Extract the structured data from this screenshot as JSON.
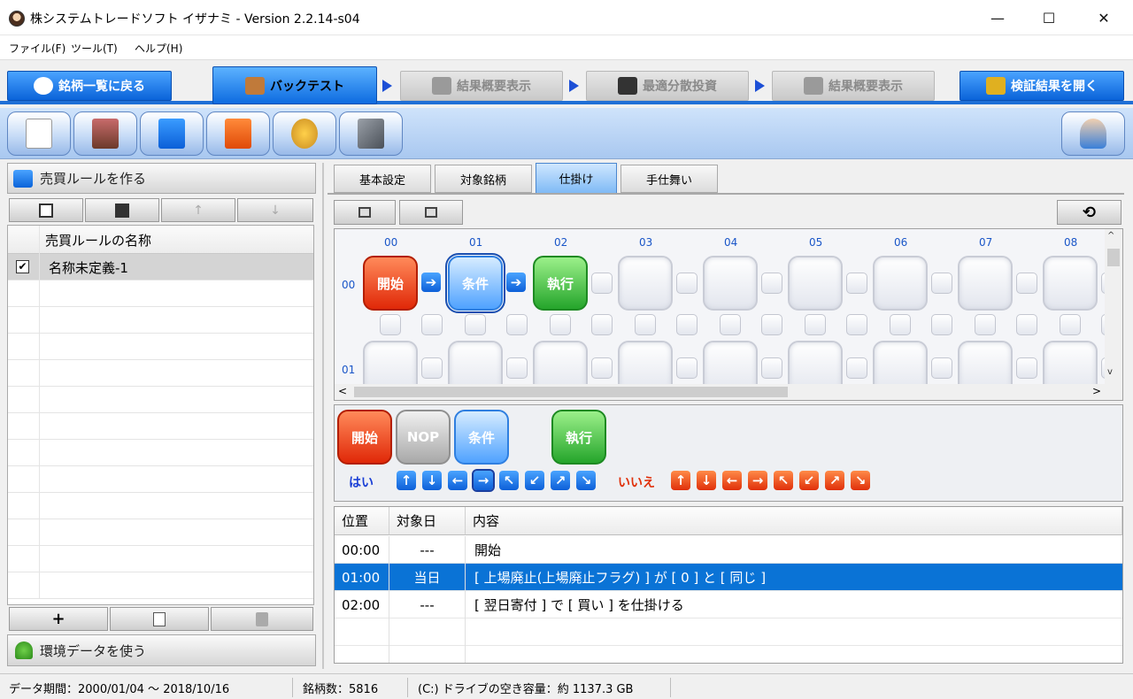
{
  "window": {
    "title": "株システムトレードソフト イザナミ - Version 2.2.14-s04",
    "minimize": "—",
    "maximize": "☐",
    "close": "✕"
  },
  "menu": {
    "items": [
      "ファイル(F)",
      "ツール(T)",
      "ヘルプ(H)"
    ]
  },
  "nav_tabs": {
    "back_list": "銘柄一覧に戻る",
    "backtest": "バックテスト",
    "result_summary_1": "結果概要表示",
    "optimal_diversified": "最適分散投資",
    "result_summary_2": "結果概要表示",
    "open_results": "検証結果を開く"
  },
  "left_panel": {
    "create_rules": "売買ルールを作る",
    "rule_column_header": "売買ルールの名称",
    "rules": [
      {
        "checked": true,
        "check_mark": "✔",
        "name": "名称未定義-1"
      }
    ],
    "env_data": "環境データを使う",
    "btn_add": "+",
    "btn_up": "↑",
    "btn_down": "↓"
  },
  "sub_tabs": [
    "基本設定",
    "対象銘柄",
    "仕掛け",
    "手仕舞い"
  ],
  "active_sub_tab": "仕掛け",
  "flow": {
    "columns": [
      "00",
      "01",
      "02",
      "03",
      "04",
      "05",
      "06",
      "07",
      "08"
    ],
    "rows": [
      "00",
      "01"
    ],
    "nodes": {
      "start": "開始",
      "condition": "条件",
      "execute": "執行"
    },
    "arrow": "➔"
  },
  "palette": {
    "start": "開始",
    "nop": "NOP",
    "condition": "条件",
    "execute": "執行",
    "yes_label": "はい",
    "no_label": "いいえ",
    "arrows": [
      "↑",
      "↓",
      "←",
      "→",
      "↖",
      "↙",
      "↗",
      "↘"
    ]
  },
  "steps": {
    "headers": [
      "位置",
      "対象日",
      "内容"
    ],
    "rows": [
      {
        "pos": "00:00",
        "day": "---",
        "content": "開始"
      },
      {
        "pos": "01:00",
        "day": "当日",
        "content": "[ 上場廃止(上場廃止フラグ) ] が [ 0 ] と [ 同じ ]"
      },
      {
        "pos": "02:00",
        "day": "---",
        "content": "[ 翌日寄付 ] で [ 買い ] を仕掛ける"
      }
    ],
    "selected_index": 1
  },
  "status": {
    "period": "データ期間：2000/01/04 〜 2018/10/16",
    "count": "銘柄数：5816",
    "disk": "(C:) ドライブの空き容量：約 1137.3 GB"
  },
  "scroll": {
    "left": "<",
    "right": ">",
    "up": "^",
    "down": "v"
  },
  "colors": {
    "accent": "#1f6fd6",
    "selected_row": "#0a73d6",
    "red_button": "#e02808",
    "blue_button": "#4fa2ff",
    "green_button": "#25a52b"
  }
}
